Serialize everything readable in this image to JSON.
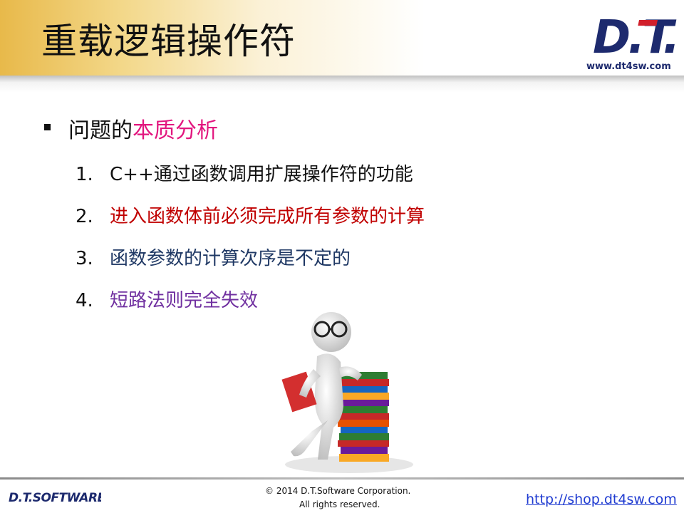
{
  "header": {
    "title": "重载逻辑操作符",
    "logo_text": "D.T.",
    "logo_url": "www.dt4sw.com"
  },
  "content": {
    "question_prefix": "问题的",
    "question_accent": "本质分析",
    "items": [
      {
        "num": "1.",
        "text": "C++通过函数调用扩展操作符的功能",
        "color": "#111111"
      },
      {
        "num": "2.",
        "text": "进入函数体前必须完成所有参数的计算",
        "color": "#c00000"
      },
      {
        "num": "3.",
        "text": "函数参数的计算次序是不定的",
        "color": "#1f3864"
      },
      {
        "num": "4.",
        "text": "短路法则完全失效",
        "color": "#7030a0"
      }
    ]
  },
  "footer": {
    "logo_text": "D.T.SOFTWARE",
    "copyright_line1": "© 2014 D.T.Software Corporation.",
    "copyright_line2": "All rights reserved.",
    "shop_url": "http://shop.dt4sw.com"
  },
  "colors": {
    "accent_pink": "#e2167f",
    "brand_blue": "#1d2a6e",
    "logo_red": "#d11f2b",
    "link_blue": "#1f3bd1"
  }
}
